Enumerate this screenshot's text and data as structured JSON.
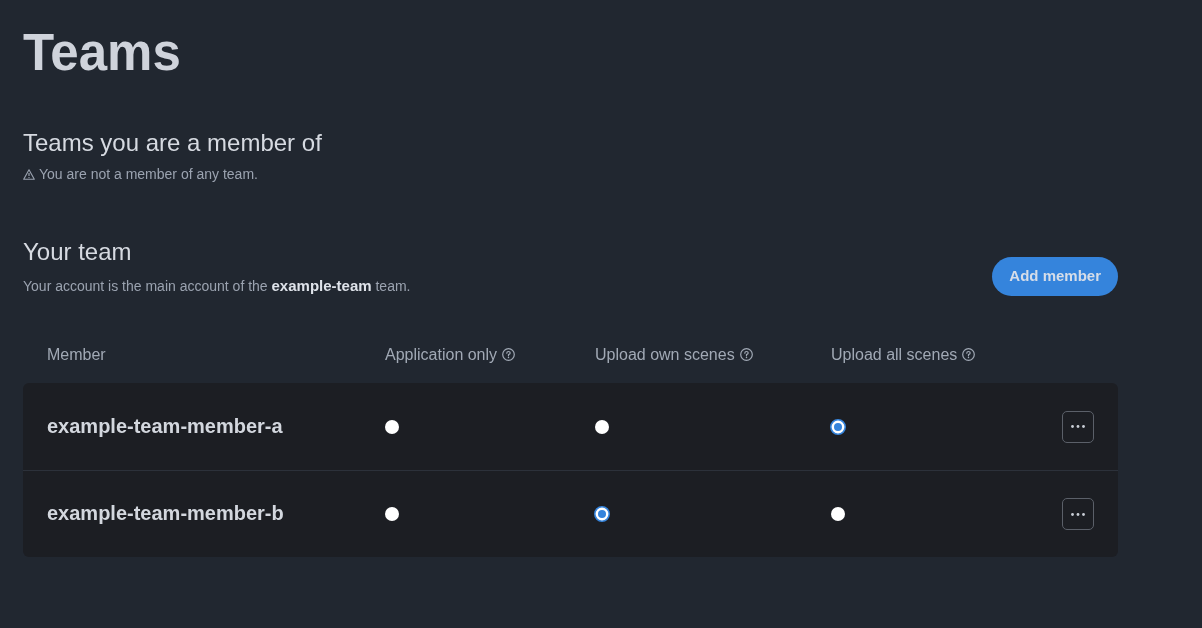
{
  "page": {
    "title": "Teams"
  },
  "memberships": {
    "heading": "Teams you are a member of",
    "notice": "You are not a member of any team."
  },
  "your_team": {
    "heading": "Your team",
    "description": "Your account is the main account of the **example-team** team.",
    "add_button": "Add member"
  },
  "table": {
    "columns": [
      {
        "label": "Member",
        "help": false
      },
      {
        "label": "Application only",
        "help": true
      },
      {
        "label": "Upload own scenes",
        "help": true
      },
      {
        "label": "Upload all scenes",
        "help": true
      }
    ],
    "rows": [
      {
        "member": "example-team-member-a",
        "permissions": [
          {
            "selected": false
          },
          {
            "selected": false
          },
          {
            "selected": true
          }
        ]
      },
      {
        "member": "example-team-member-b",
        "permissions": [
          {
            "selected": false
          },
          {
            "selected": true
          },
          {
            "selected": false
          }
        ]
      }
    ]
  }
}
